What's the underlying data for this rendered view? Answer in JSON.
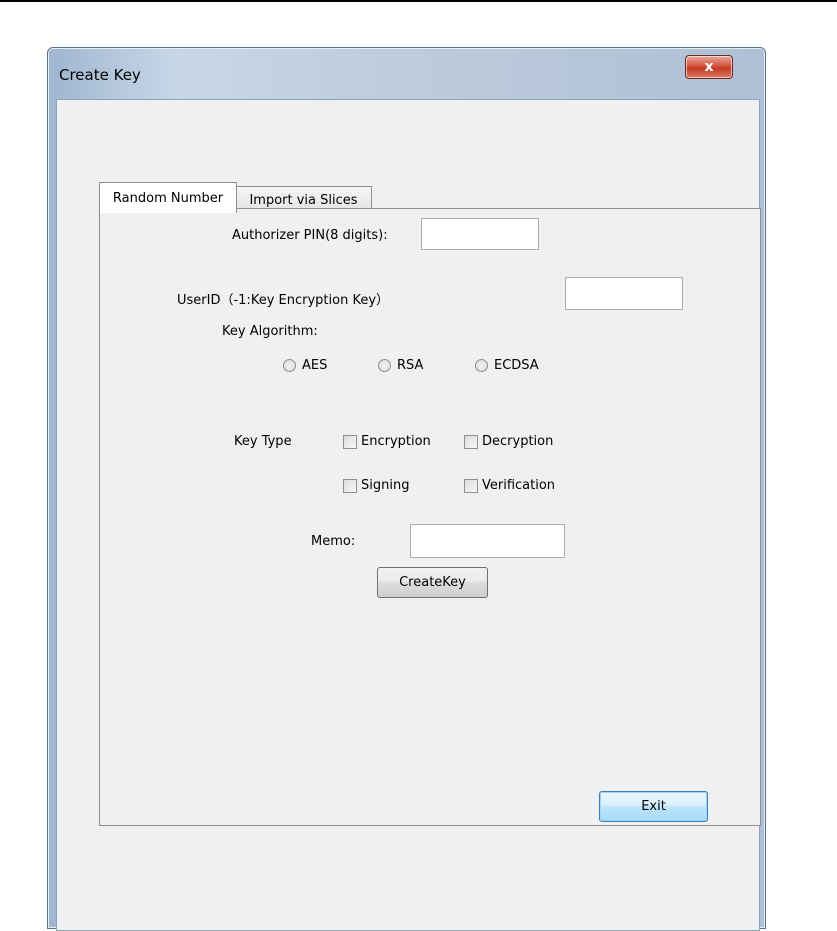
{
  "window": {
    "title": "Create Key",
    "close_glyph": "x"
  },
  "tabs": [
    {
      "label": "Random Number",
      "active": true
    },
    {
      "label": "Import via Slices",
      "active": false
    }
  ],
  "form": {
    "pin_label": "Authorizer PIN(8 digits):",
    "pin_value": "",
    "userid_label": "UserID（-1:Key Encryption Key）",
    "userid_value": "",
    "algorithm_label": "Key Algorithm:",
    "algorithms": [
      {
        "label": "AES",
        "checked": false
      },
      {
        "label": "RSA",
        "checked": false
      },
      {
        "label": "ECDSA",
        "checked": false
      }
    ],
    "keytype_label": "Key Type",
    "keytypes": [
      {
        "label": "Encryption",
        "checked": false
      },
      {
        "label": "Decryption",
        "checked": false
      },
      {
        "label": "Signing",
        "checked": false
      },
      {
        "label": "Verification",
        "checked": false
      }
    ],
    "memo_label": "Memo:",
    "memo_value": "",
    "create_button": "CreateKey"
  },
  "footer": {
    "exit_button": "Exit"
  },
  "colors": {
    "dialog_bg": "#f0f0f0",
    "close_button": "#c43b24",
    "default_button_border": "#3c7fb1"
  }
}
